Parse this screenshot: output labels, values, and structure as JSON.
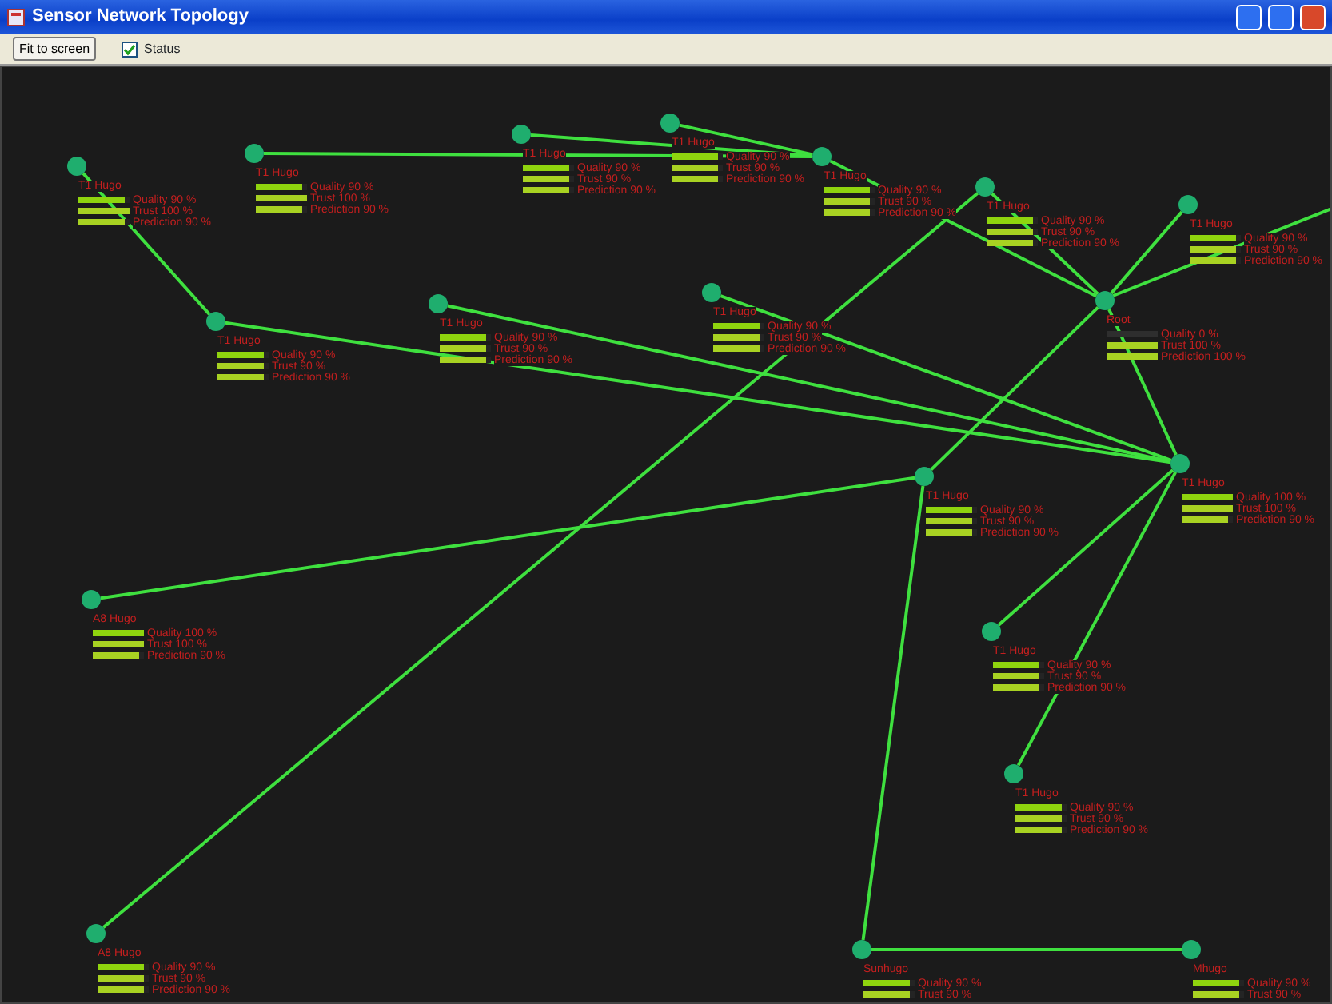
{
  "window": {
    "title": "Sensor Network Topology"
  },
  "toolbar": {
    "fit_button": "Fit to screen",
    "status_checkbox": {
      "label": "Status",
      "checked": true
    }
  },
  "nodes": [
    {
      "name": "T1 Hugo",
      "metrics": [
        {
          "label": "Quality 90 %",
          "level": 0.9
        },
        {
          "label": "Trust 100 %",
          "level": 1
        },
        {
          "label": "Prediction 90 %",
          "level": 0.9
        }
      ]
    },
    {
      "name": "T1 Hugo",
      "metrics": [
        {
          "label": "Quality 90 %",
          "level": 0.9
        },
        {
          "label": "Trust 100 %",
          "level": 1
        },
        {
          "label": "Prediction 90 %",
          "level": 0.9
        }
      ]
    },
    {
      "name": "T1 Hugo",
      "metrics": [
        {
          "label": "Quality 90 %",
          "level": 0.9
        },
        {
          "label": "Trust 90 %",
          "level": 0.9
        },
        {
          "label": "Prediction 90 %",
          "level": 0.9
        }
      ]
    },
    {
      "name": "T1 Hugo",
      "metrics": [
        {
          "label": "Quality 90 %",
          "level": 0.9
        },
        {
          "label": "Trust 90 %",
          "level": 0.9
        },
        {
          "label": "Prediction 90 %",
          "level": 0.9
        }
      ]
    },
    {
      "name": "T1 Hugo",
      "metrics": [
        {
          "label": "Quality 90 %",
          "level": 0.9
        },
        {
          "label": "Trust 90 %",
          "level": 0.9
        },
        {
          "label": "Prediction 90 %",
          "level": 0.9
        }
      ]
    },
    {
      "name": "T1 Hugo",
      "metrics": [
        {
          "label": "Quality 90 %",
          "level": 0.9
        },
        {
          "label": "Trust 90 %",
          "level": 0.9
        },
        {
          "label": "Prediction 90 %",
          "level": 0.9
        }
      ]
    },
    {
      "name": "T1 Hugo",
      "metrics": [
        {
          "label": "Quality 90 %",
          "level": 0.9
        },
        {
          "label": "Trust 90 %",
          "level": 0.9
        },
        {
          "label": "Prediction 90 %",
          "level": 0.9
        }
      ]
    },
    {
      "name": "Root",
      "metrics": [
        {
          "label": "Quality 0 %",
          "level": 0
        },
        {
          "label": "Trust 100 %",
          "level": 1
        },
        {
          "label": "Prediction 100 %",
          "level": 1
        }
      ]
    },
    {
      "name": "T1 Hugo",
      "metrics": [
        {
          "label": "Quality 90 %",
          "level": 0.9
        },
        {
          "label": "Trust 90 %",
          "level": 0.9
        },
        {
          "label": "Prediction 90 %",
          "level": 0.9
        }
      ]
    },
    {
      "name": "T1 Hugo",
      "metrics": [
        {
          "label": "Quality 90 %",
          "level": 0.9
        },
        {
          "label": "Trust 90 %",
          "level": 0.9
        },
        {
          "label": "Prediction 90 %",
          "level": 0.9
        }
      ]
    },
    {
      "name": "T1 Hugo",
      "metrics": [
        {
          "label": "Quality 90 %",
          "level": 0.9
        },
        {
          "label": "Trust 90 %",
          "level": 0.9
        },
        {
          "label": "Prediction 90 %",
          "level": 0.9
        }
      ]
    },
    {
      "name": "T1 Hugo",
      "metrics": [
        {
          "label": "Quality 90 %",
          "level": 0.9
        },
        {
          "label": "Trust 90 %",
          "level": 0.9
        },
        {
          "label": "Prediction 90 %",
          "level": 0.9
        }
      ]
    },
    {
      "name": "T1 Hugo",
      "metrics": [
        {
          "label": "Quality 100 %",
          "level": 1
        },
        {
          "label": "Trust 100 %",
          "level": 1
        },
        {
          "label": "Prediction 90 %",
          "level": 0.9
        }
      ]
    },
    {
      "name": "A8 Hugo",
      "metrics": [
        {
          "label": "Quality 100 %",
          "level": 1
        },
        {
          "label": "Trust 100 %",
          "level": 1
        },
        {
          "label": "Prediction 90 %",
          "level": 0.9
        }
      ]
    },
    {
      "name": "T1 Hugo",
      "metrics": [
        {
          "label": "Quality 90 %",
          "level": 0.9
        },
        {
          "label": "Trust 90 %",
          "level": 0.9
        },
        {
          "label": "Prediction 90 %",
          "level": 0.9
        }
      ]
    },
    {
      "name": "T1 Hugo",
      "metrics": [
        {
          "label": "Quality 90 %",
          "level": 0.9
        },
        {
          "label": "Trust 90 %",
          "level": 0.9
        },
        {
          "label": "Prediction 90 %",
          "level": 0.9
        }
      ]
    },
    {
      "name": "A8 Hugo",
      "metrics": [
        {
          "label": "Quality 90 %",
          "level": 0.9
        },
        {
          "label": "Trust 90 %",
          "level": 0.9
        },
        {
          "label": "Prediction 90 %",
          "level": 0.9
        }
      ]
    },
    {
      "name": "Sunhugo",
      "metrics": [
        {
          "label": "Quality 90 %",
          "level": 0.9
        },
        {
          "label": "Trust 90 %",
          "level": 0.9
        }
      ]
    },
    {
      "name": "Mhugo",
      "metrics": [
        {
          "label": "Quality 90 %",
          "level": 0.9
        },
        {
          "label": "Trust 90 %",
          "level": 0.9
        }
      ]
    }
  ]
}
